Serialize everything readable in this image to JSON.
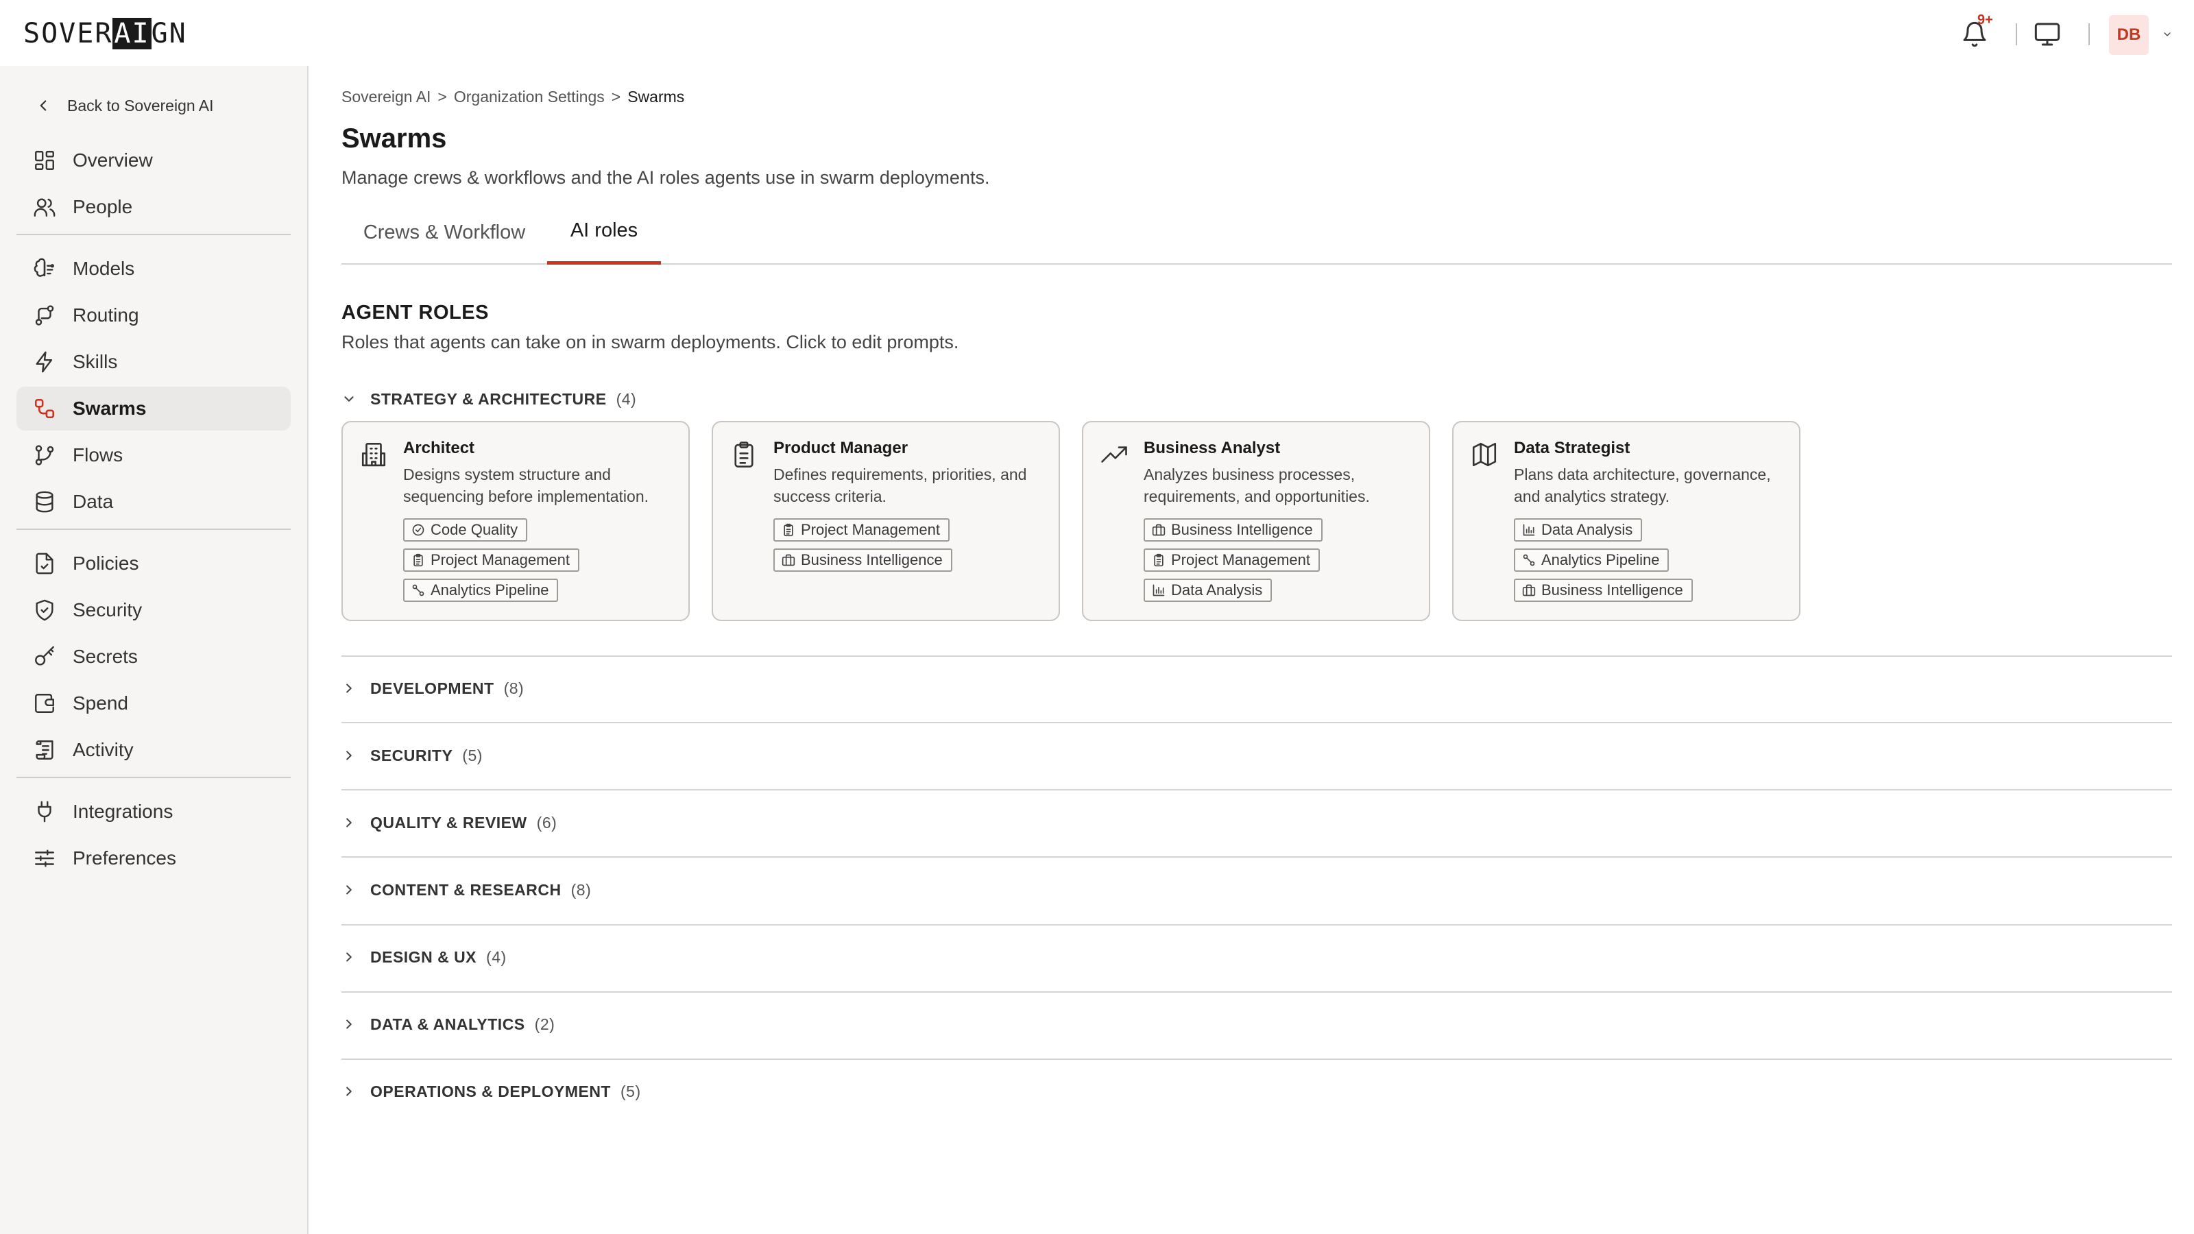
{
  "header": {
    "logo_pre": "SOVER",
    "logo_inv": "AI",
    "logo_post": "GN",
    "notifications_badge": "9+",
    "avatar_initials": "DB"
  },
  "sidebar": {
    "back_label": "Back to Sovereign AI",
    "items": [
      {
        "label": "Overview",
        "icon": "grid-icon"
      },
      {
        "label": "People",
        "icon": "people-icon"
      },
      {
        "label": "Models",
        "icon": "brain-icon"
      },
      {
        "label": "Routing",
        "icon": "route-icon"
      },
      {
        "label": "Skills",
        "icon": "lightning-icon"
      },
      {
        "label": "Swarms",
        "icon": "swarm-icon",
        "active": true
      },
      {
        "label": "Flows",
        "icon": "branch-icon"
      },
      {
        "label": "Data",
        "icon": "database-icon"
      },
      {
        "label": "Policies",
        "icon": "document-icon"
      },
      {
        "label": "Security",
        "icon": "shield-icon"
      },
      {
        "label": "Secrets",
        "icon": "key-icon"
      },
      {
        "label": "Spend",
        "icon": "wallet-icon"
      },
      {
        "label": "Activity",
        "icon": "log-icon"
      },
      {
        "label": "Integrations",
        "icon": "plug-icon"
      },
      {
        "label": "Preferences",
        "icon": "sliders-icon"
      }
    ]
  },
  "breadcrumb": {
    "items": [
      "Sovereign AI",
      "Organization Settings",
      "Swarms"
    ],
    "separator": ">"
  },
  "page": {
    "title": "Swarms",
    "description": "Manage crews & workflows and the AI roles agents use in swarm deployments."
  },
  "tabs": [
    {
      "label": "Crews & Workflow",
      "active": false
    },
    {
      "label": "AI roles",
      "active": true
    }
  ],
  "section": {
    "title": "AGENT ROLES",
    "description": "Roles that agents can take on in swarm deployments. Click to edit prompts."
  },
  "groups": [
    {
      "name": "STRATEGY & ARCHITECTURE",
      "count": "(4)",
      "expanded": true,
      "cards": [
        {
          "title": "Architect",
          "icon": "building-icon",
          "description": "Designs system structure and sequencing before implementation.",
          "tags": [
            {
              "label": "Code Quality",
              "icon": "check-circle-icon"
            },
            {
              "label": "Project Management",
              "icon": "clipboard-icon"
            },
            {
              "label": "Analytics Pipeline",
              "icon": "pipeline-icon"
            }
          ]
        },
        {
          "title": "Product Manager",
          "icon": "clipboard-icon",
          "description": "Defines requirements, priorities, and success criteria.",
          "tags": [
            {
              "label": "Project Management",
              "icon": "clipboard-icon"
            },
            {
              "label": "Business Intelligence",
              "icon": "briefcase-icon"
            }
          ]
        },
        {
          "title": "Business Analyst",
          "icon": "trend-up-icon",
          "description": "Analyzes business processes, requirements, and opportunities.",
          "tags": [
            {
              "label": "Business Intelligence",
              "icon": "briefcase-icon"
            },
            {
              "label": "Project Management",
              "icon": "clipboard-icon"
            },
            {
              "label": "Data Analysis",
              "icon": "bar-chart-icon"
            }
          ]
        },
        {
          "title": "Data Strategist",
          "icon": "map-icon",
          "description": "Plans data architecture, governance, and analytics strategy.",
          "tags": [
            {
              "label": "Data Analysis",
              "icon": "bar-chart-icon"
            },
            {
              "label": "Analytics Pipeline",
              "icon": "pipeline-icon"
            },
            {
              "label": "Business Intelligence",
              "icon": "briefcase-icon"
            }
          ]
        }
      ]
    },
    {
      "name": "DEVELOPMENT",
      "count": "(8)",
      "expanded": false
    },
    {
      "name": "SECURITY",
      "count": "(5)",
      "expanded": false
    },
    {
      "name": "QUALITY & REVIEW",
      "count": "(6)",
      "expanded": false
    },
    {
      "name": "CONTENT & RESEARCH",
      "count": "(8)",
      "expanded": false
    },
    {
      "name": "DESIGN & UX",
      "count": "(4)",
      "expanded": false
    },
    {
      "name": "DATA & ANALYTICS",
      "count": "(2)",
      "expanded": false
    },
    {
      "name": "OPERATIONS & DEPLOYMENT",
      "count": "(5)",
      "expanded": false
    }
  ],
  "colors": {
    "accent": "#c8321e",
    "sidebar_bg": "#f6f5f4",
    "active_item_bg": "#ebe9e7",
    "avatar_bg": "#fbe4e1"
  }
}
